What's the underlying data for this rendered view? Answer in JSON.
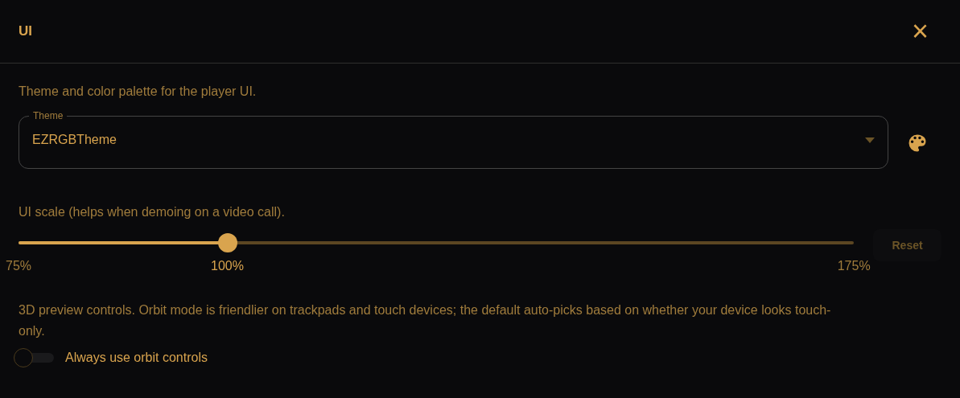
{
  "dialog": {
    "title": "UI",
    "close": "×"
  },
  "theme_section": {
    "description": "Theme and color palette for the player UI.",
    "select": {
      "label": "Theme",
      "value": "EZRGBTheme"
    }
  },
  "scale_section": {
    "description": "UI scale (helps when demoing on a video call).",
    "slider": {
      "level": 0.25
    },
    "marks": [
      {
        "kind": "start",
        "label": "75%"
      },
      {
        "kind": "current",
        "label": "100%"
      },
      {
        "kind": "end",
        "label": "175%"
      }
    ],
    "reset": {
      "label": "Reset",
      "disabled": true
    }
  },
  "controls_section": {
    "description": "3D preview controls. Orbit mode is friendlier on trackpads and touch devices; the default auto-picks based on whether your device looks touch-only.",
    "toggle": {
      "label": "Always use orbit controls",
      "on": false
    }
  }
}
